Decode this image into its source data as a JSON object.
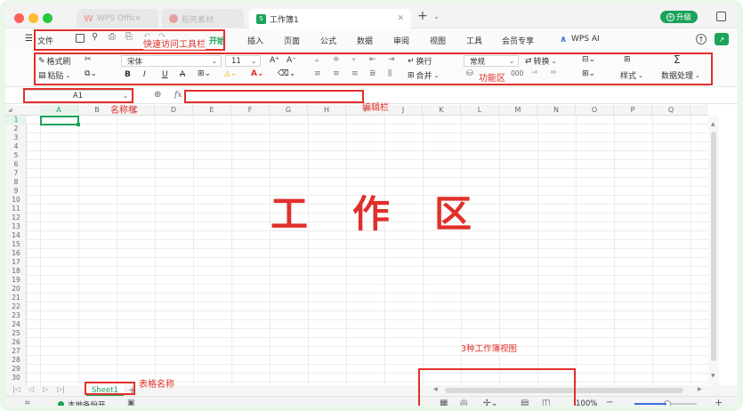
{
  "titlebar": {
    "tabs": [
      {
        "label": "WPS Office",
        "state": "dim"
      },
      {
        "label": "稻壳素材",
        "state": "dim"
      },
      {
        "label": "工作簿1",
        "state": "active"
      }
    ],
    "new_tab": "+",
    "upgrade_label": "升级"
  },
  "menubar": {
    "file_label": "文件",
    "items": [
      "开始",
      "插入",
      "页面",
      "公式",
      "数据",
      "审阅",
      "视图",
      "工具",
      "会员专享",
      "WPS AI"
    ]
  },
  "ribbon": {
    "format_painter": "格式刷",
    "paste": "粘贴",
    "font_name": "宋体",
    "font_size": "11",
    "bold": "B",
    "italic": "I",
    "underline": "U",
    "wrap": "换行",
    "merge": "合并",
    "number_format": "常规",
    "convert": "转换",
    "styles": "样式",
    "data_processing": "数据处理"
  },
  "formula_bar": {
    "name_box": "A1",
    "fx": "fx",
    "formula_value": ""
  },
  "grid": {
    "columns": [
      "A",
      "B",
      "C",
      "D",
      "E",
      "F",
      "G",
      "H",
      "I",
      "J",
      "K",
      "L",
      "M",
      "N",
      "O",
      "P",
      "Q"
    ],
    "rows": [
      "1",
      "2",
      "3",
      "4",
      "5",
      "6",
      "7",
      "8",
      "9",
      "10",
      "11",
      "12",
      "13",
      "14",
      "15",
      "16",
      "17",
      "18",
      "19",
      "20",
      "21",
      "22",
      "23",
      "24",
      "25",
      "26",
      "27",
      "28",
      "29",
      "30"
    ]
  },
  "sheets": {
    "active": "Sheet1",
    "add": "+"
  },
  "statusbar": {
    "backup": "本地备份开",
    "zoom": "100%"
  },
  "annotations": {
    "quick_access": "快速访问工具栏",
    "ribbon_area": "功能区",
    "name_box": "名称框",
    "edit_bar": "编辑栏",
    "workspace": "工　作　区",
    "sheet_name": "表格名称",
    "views": "3种工作簿视图"
  },
  "colors": {
    "annotation": "#e0302a",
    "accent_green": "#1ba35a",
    "active_cell": "#1ba35a"
  }
}
